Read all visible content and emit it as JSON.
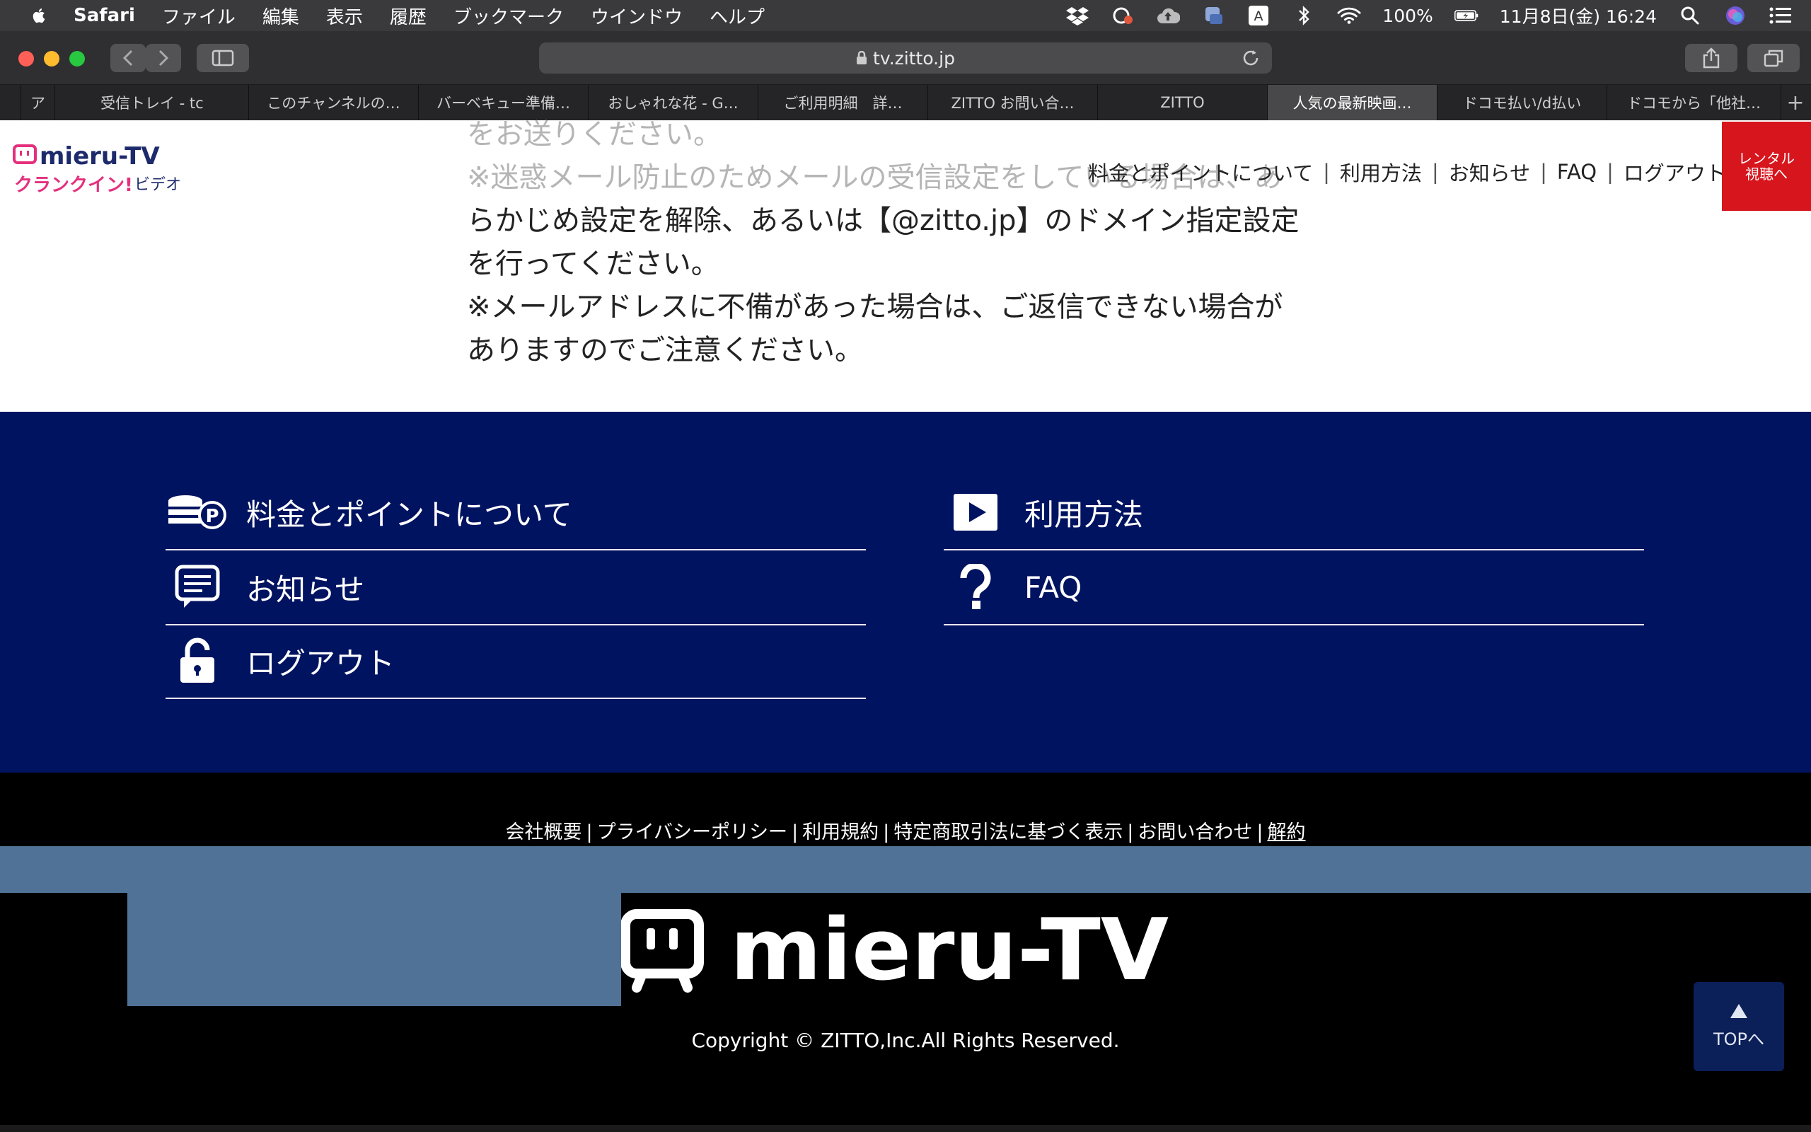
{
  "menubar": {
    "app": "Safari",
    "items": [
      "ファイル",
      "編集",
      "表示",
      "履歴",
      "ブックマーク",
      "ウインドウ",
      "ヘルプ"
    ],
    "battery": "100%",
    "datetime": "11月8日(金)  16:24",
    "input_indicator": "A"
  },
  "browser": {
    "url": "tv.zitto.jp",
    "tabs": [
      {
        "label": ""
      },
      {
        "label": "ア"
      },
      {
        "label": "受信トレイ - tc"
      },
      {
        "label": "このチャンネルの…"
      },
      {
        "label": "バーベキュー準備…"
      },
      {
        "label": "おしゃれな花 - G…"
      },
      {
        "label": "ご利用明細　詳…"
      },
      {
        "label": "ZITTO お問い合…"
      },
      {
        "label": "ZITTO"
      },
      {
        "label": "人気の最新映画…"
      },
      {
        "label": "ドコモ払い/d払い"
      },
      {
        "label": "ドコモから「他社…"
      }
    ],
    "new_tab": "+"
  },
  "header": {
    "nav": [
      "料金とポイントについて",
      "利用方法",
      "お知らせ",
      "FAQ",
      "ログアウト"
    ],
    "nav_separator": "|",
    "rental_line1": "レンタル",
    "rental_line2": "視聴へ"
  },
  "body_text": {
    "line0": "をお送りください。",
    "line1": "※迷惑メール防止のためメールの受信設定をしている場合は、あ",
    "line2": "らかじめ設定を解除、あるいは【@zitto.jp】のドメイン指定設定",
    "line3": "を行ってください。",
    "line4": "※メールアドレスに不備があった場合は、ご返信できない場合が",
    "line5": "ありますのでご注意ください。"
  },
  "footer_nav": {
    "pricing": "料金とポイントについて",
    "howto": "利用方法",
    "news": "お知らせ",
    "faq": "FAQ",
    "logout": "ログアウト"
  },
  "footer_links": [
    "会社概要",
    "プライバシーポリシー",
    "利用規約",
    "特定商取引法に基づく表示",
    "お問い合わせ",
    "解約"
  ],
  "footer_separator": "|",
  "copyright": "Copyright © ZITTO,Inc.All Rights Reserved.",
  "top_button": "TOPへ",
  "colors": {
    "nav_blue": "#001360",
    "rental_red": "#d7151d",
    "logo_navy": "#1d2a6b",
    "logo_pink": "#e4307d",
    "steel": "#4f7296"
  }
}
